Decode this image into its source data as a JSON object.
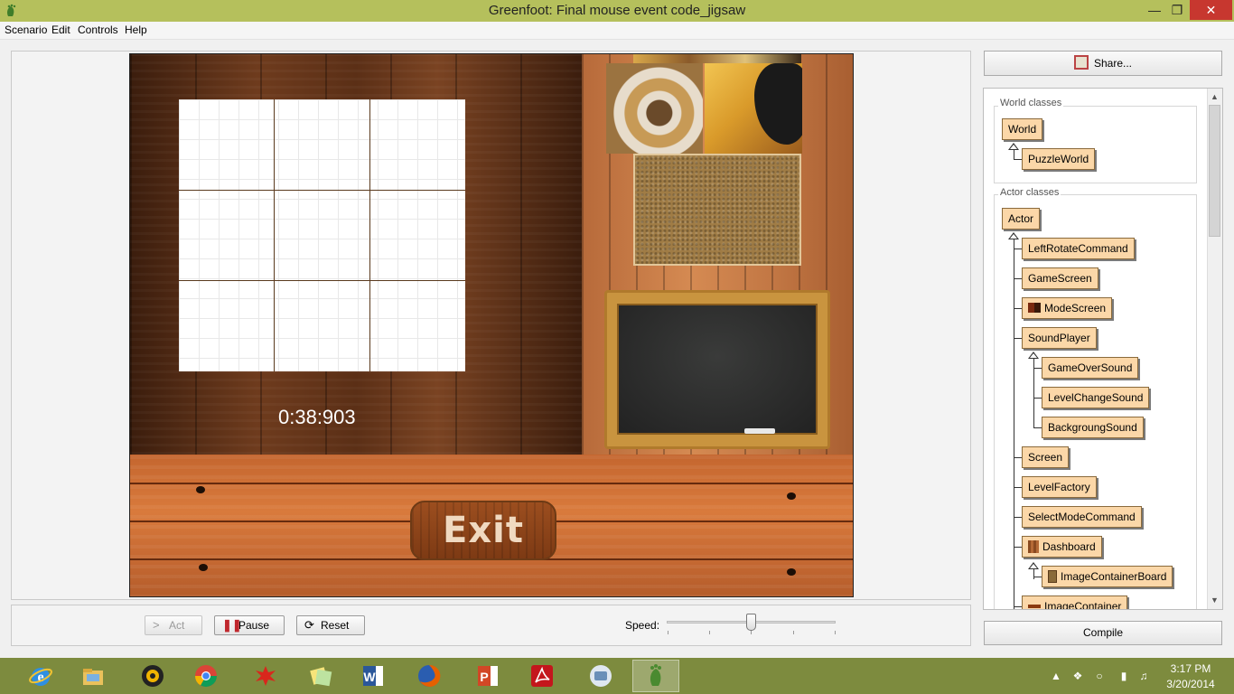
{
  "window": {
    "title": "Greenfoot: Final mouse event code_jigsaw"
  },
  "menu": {
    "items": [
      "Scenario",
      "Edit",
      "Controls",
      "Help"
    ]
  },
  "world": {
    "timer": "0:38:903",
    "exit_label": "Exit"
  },
  "controls": {
    "act_label": "Act",
    "pause_label": "Pause",
    "reset_label": "Reset",
    "speed_label": "Speed:",
    "speed_fraction": 0.5
  },
  "right_panel": {
    "share_label": "Share...",
    "compile_label": "Compile",
    "world_classes_title": "World classes",
    "actor_classes_title": "Actor classes",
    "world_classes": [
      "World",
      "PuzzleWorld"
    ],
    "actor_classes": [
      "Actor",
      "LeftRotateCommand",
      "GameScreen",
      "ModeScreen",
      "SoundPlayer",
      "GameOverSound",
      "LevelChangeSound",
      "BackgroungSound",
      "Screen",
      "LevelFactory",
      "SelectModeCommand",
      "Dashboard",
      "ImageContainerBoard",
      "ImageContainer"
    ]
  },
  "taskbar": {
    "apps": [
      "internet-explorer",
      "file-explorer",
      "media-player",
      "chrome",
      "paint",
      "sticky-notes",
      "word",
      "firefox",
      "powerpoint",
      "acrobat",
      "disk-utility",
      "greenfoot"
    ],
    "clock_time": "3:17 PM",
    "clock_date": "3/20/2014"
  }
}
